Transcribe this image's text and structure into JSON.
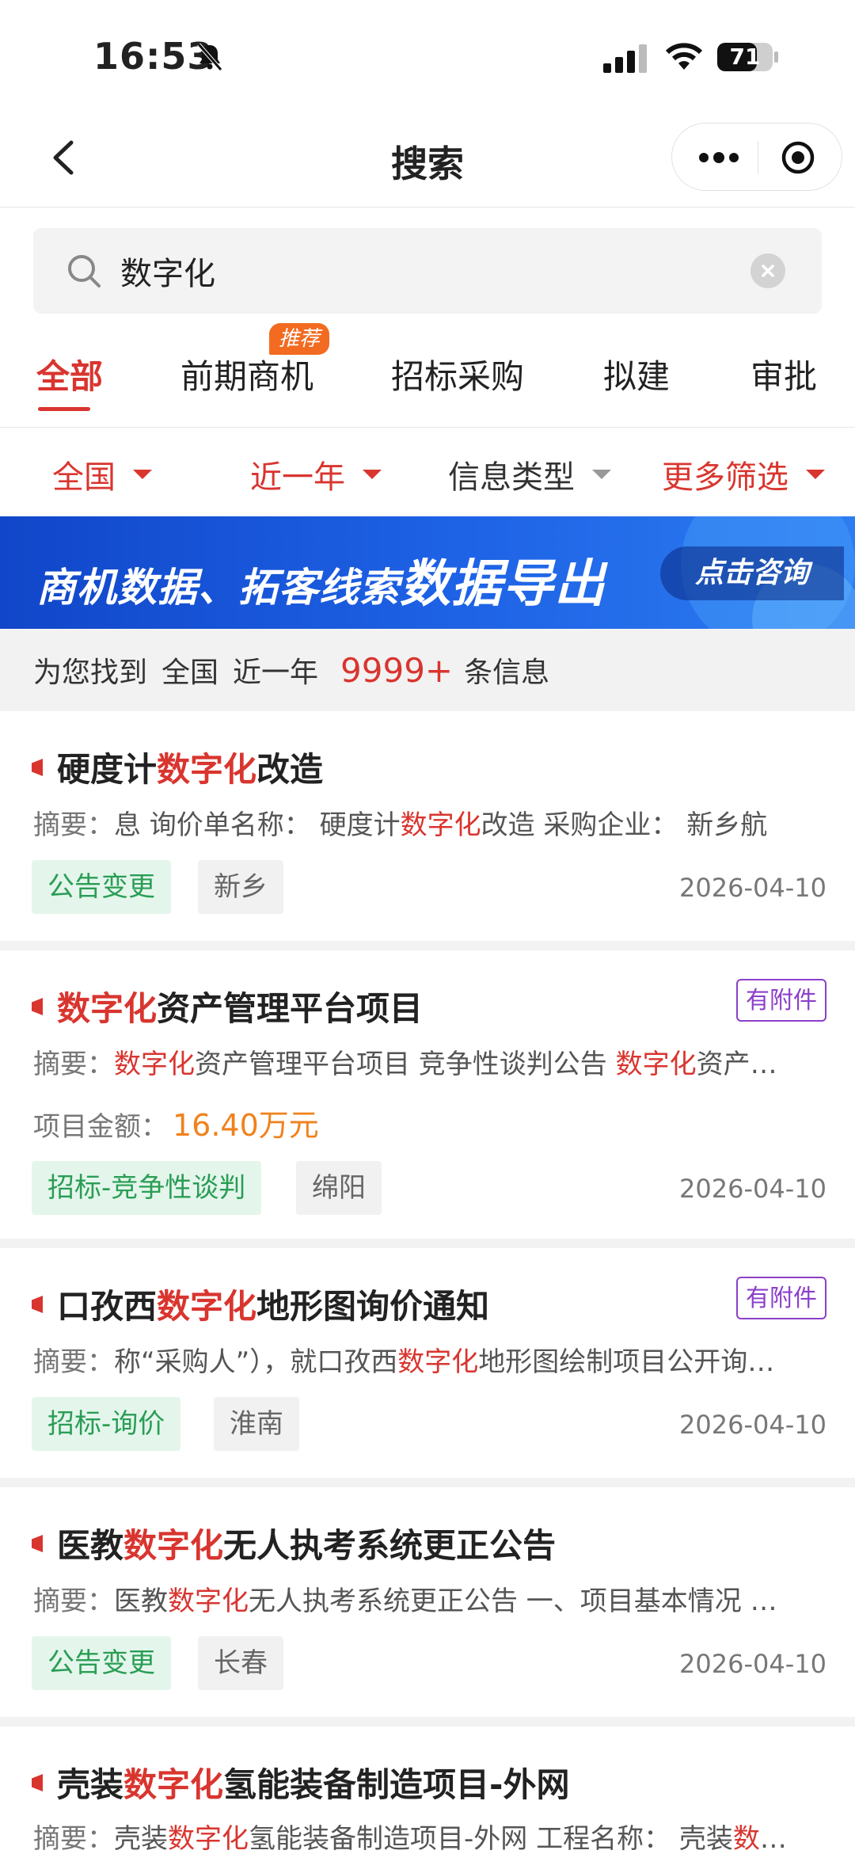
{
  "status_bar": {
    "time": "16:53",
    "battery": "71"
  },
  "header": {
    "title": "搜索"
  },
  "search": {
    "value": "数字化",
    "placeholder": ""
  },
  "tabs": [
    {
      "label": "全部",
      "active": true
    },
    {
      "label": "前期商机",
      "badge": "推荐"
    },
    {
      "label": "招标采购"
    },
    {
      "label": "拟建"
    },
    {
      "label": "审批"
    }
  ],
  "filters": [
    {
      "label": "全国"
    },
    {
      "label": "近一年"
    },
    {
      "label": "信息类型"
    },
    {
      "label": "更多筛选"
    }
  ],
  "banner": {
    "text": "商机数据、拓客线索",
    "highlight": "数据导出",
    "cta": "点击咨询"
  },
  "summary": {
    "prefix": "为您找到",
    "region": "全国",
    "period": "近一年",
    "count": "9999+",
    "suffix": "条信息"
  },
  "abstract_label": "摘要：",
  "amount_label": "项目金额：",
  "attachment_label": "有附件",
  "results": [
    {
      "title_pre": "硬度计",
      "title_hl": "数字化",
      "title_post": "改造",
      "abstract_pre": "息 询价单名称：  硬度计",
      "abstract_hl": "数字化",
      "abstract_post": "改造 采购企业：  新乡航",
      "abstract_hl2": "",
      "abstract_post2": "",
      "tag": "公告变更",
      "region": "新乡",
      "date": "2026-04-10"
    },
    {
      "title_pre": "",
      "title_hl": "数字化",
      "title_post": "资产管理平台项目",
      "abstract_pre": "",
      "abstract_hl": "数字化",
      "abstract_post": "资产管理平台项目 竞争性谈判公告 ",
      "abstract_hl2": "数字化",
      "abstract_post2": "资产…",
      "amount": "16.40万元",
      "tag": "招标-竞争性谈判",
      "region": "绵阳",
      "date": "2026-04-10"
    },
    {
      "title_pre": "口孜西",
      "title_hl": "数字化",
      "title_post": "地形图询价通知",
      "abstract_pre": "称“采购人”），就口孜西",
      "abstract_hl": "数字化",
      "abstract_post": "地形图绘制项目公开询…",
      "abstract_hl2": "",
      "abstract_post2": "",
      "tag": "招标-询价",
      "region": "淮南",
      "date": "2026-04-10"
    },
    {
      "title_pre": "医教",
      "title_hl": "数字化",
      "title_post": "无人执考系统更正公告",
      "abstract_pre": "医教",
      "abstract_hl": "数字化",
      "abstract_post": "无人执考系统更正公告 一、项目基本情况 …",
      "abstract_hl2": "",
      "abstract_post2": "",
      "tag": "公告变更",
      "region": "长春",
      "date": "2026-04-10"
    },
    {
      "title_pre": "壳装",
      "title_hl": "数字化",
      "title_post": "氢能装备制造项目-外网",
      "abstract_pre": "壳装",
      "abstract_hl": "数字化",
      "abstract_post": "氢能装备制造项目-外网 工程名称：  壳装",
      "abstract_hl2": "数",
      "abstract_post2": "…"
    }
  ]
}
